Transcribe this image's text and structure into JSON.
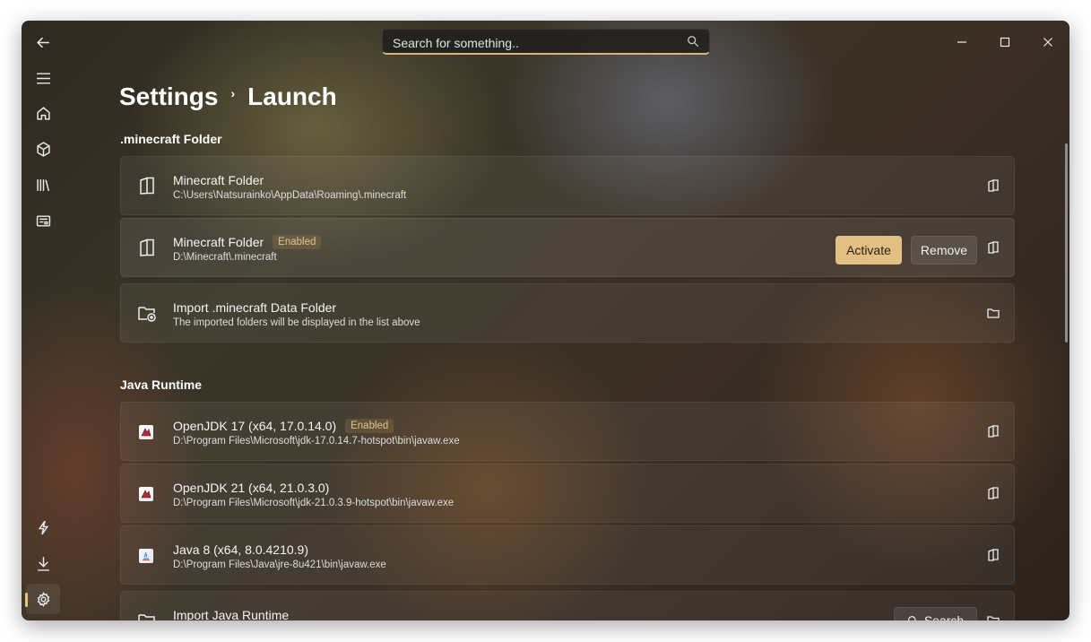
{
  "search": {
    "placeholder": "Search for something.."
  },
  "breadcrumb": {
    "parent": "Settings",
    "separator": "›",
    "current": "Launch"
  },
  "sections": {
    "minecraft": {
      "title": ".minecraft Folder"
    },
    "java": {
      "title": "Java Runtime"
    }
  },
  "minecraft_folders": [
    {
      "title": "Minecraft Folder",
      "path": "C:\\Users\\Natsurainko\\AppData\\Roaming\\.minecraft"
    },
    {
      "title": "Minecraft Folder",
      "badge": "Enabled",
      "path": "D:\\Minecraft\\.minecraft",
      "activate": "Activate",
      "remove": "Remove"
    },
    {
      "title": "Import .minecraft Data Folder",
      "path": "The imported folders will be displayed in the list above"
    }
  ],
  "java_runtimes": [
    {
      "title": "OpenJDK 17 (x64, 17.0.14.0)",
      "badge": "Enabled",
      "path": "D:\\Program Files\\Microsoft\\jdk-17.0.14.7-hotspot\\bin\\javaw.exe"
    },
    {
      "title": "OpenJDK 21 (x64, 21.0.3.0)",
      "path": "D:\\Program Files\\Microsoft\\jdk-21.0.3.9-hotspot\\bin\\javaw.exe"
    },
    {
      "title": "Java 8 (x64, 8.0.4210.9)",
      "path": "D:\\Program Files\\Java\\jre-8u421\\bin\\javaw.exe"
    },
    {
      "title": "Import Java Runtime",
      "search": "Search"
    }
  ],
  "colors": {
    "accent": "#e2bf83",
    "badge_text": "#e3c48e"
  }
}
